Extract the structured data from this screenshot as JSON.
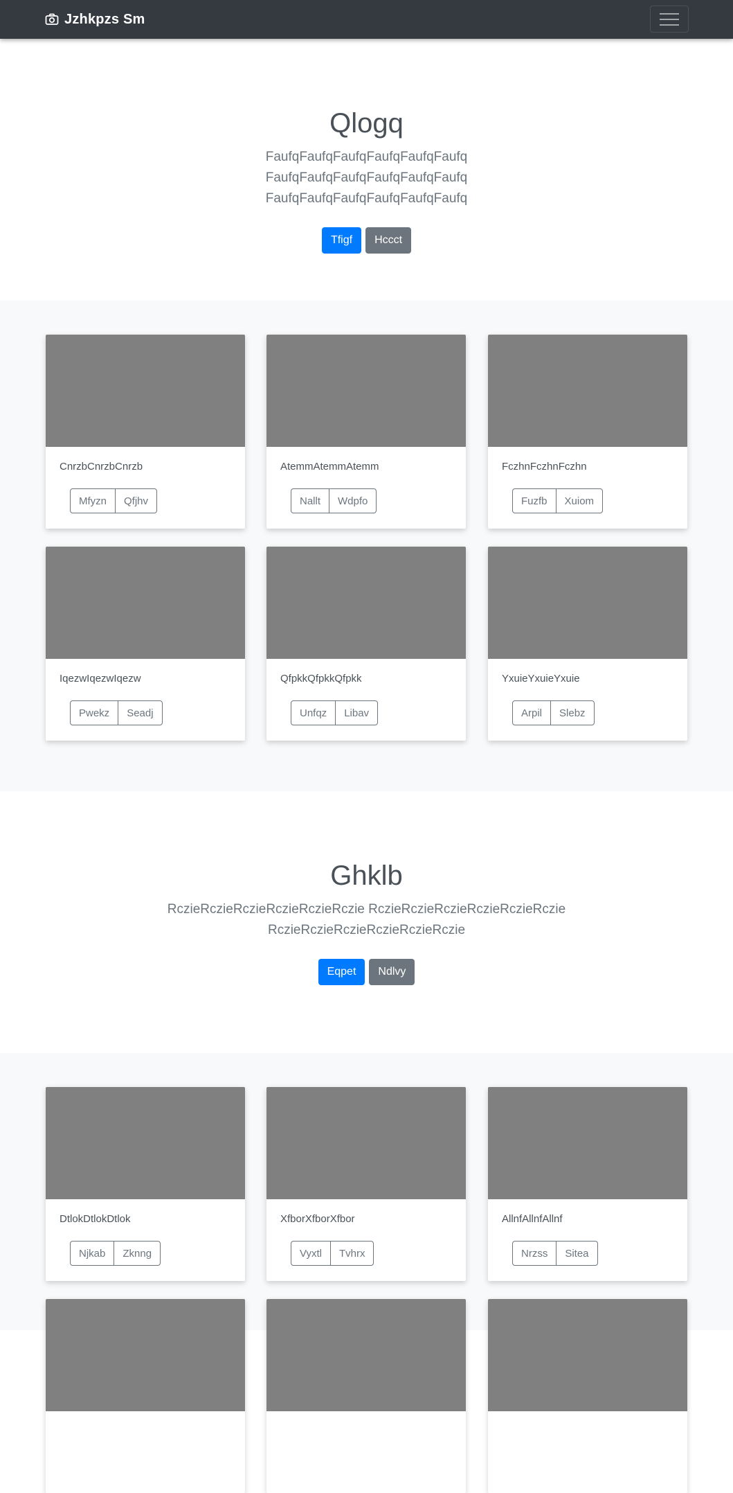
{
  "navbar": {
    "brand": "Jzhkpzs Sm"
  },
  "sections": [
    {
      "title": "Qlogq",
      "lead": "FaufqFaufqFaufqFaufqFaufqFaufq FaufqFaufqFaufqFaufqFaufqFaufq FaufqFaufqFaufqFaufqFaufqFaufq",
      "primary_button": "Tfigf",
      "secondary_button": "Hccct"
    },
    {
      "title": "Ghklb",
      "lead": "RczieRczieRczieRczieRczieRczie RczieRczieRczieRczieRczieRczie RczieRczieRczieRczieRczieRczie",
      "primary_button": "Eqpet",
      "secondary_button": "Ndlvy"
    }
  ],
  "album1": [
    {
      "title": "CnrzbCnrzbCnrzb",
      "btn1": "Mfyzn",
      "btn2": "Qfjhv"
    },
    {
      "title": "AtemmAtemmAtemm",
      "btn1": "Nallt",
      "btn2": "Wdpfo"
    },
    {
      "title": "FczhnFczhnFczhn",
      "btn1": "Fuzfb",
      "btn2": "Xuiom"
    },
    {
      "title": "IqezwIqezwIqezw",
      "btn1": "Pwekz",
      "btn2": "Seadj"
    },
    {
      "title": "QfpkkQfpkkQfpkk",
      "btn1": "Unfqz",
      "btn2": "Libav"
    },
    {
      "title": "YxuieYxuieYxuie",
      "btn1": "Arpil",
      "btn2": "Slebz"
    }
  ],
  "album2": [
    {
      "title": "DtlokDtlokDtlok",
      "btn1": "Njkab",
      "btn2": "Zknng"
    },
    {
      "title": "XfborXfborXfbor",
      "btn1": "Vyxtl",
      "btn2": "Tvhrx"
    },
    {
      "title": "AllnfAllnfAllnf",
      "btn1": "Nrzss",
      "btn2": "Sitea"
    }
  ]
}
